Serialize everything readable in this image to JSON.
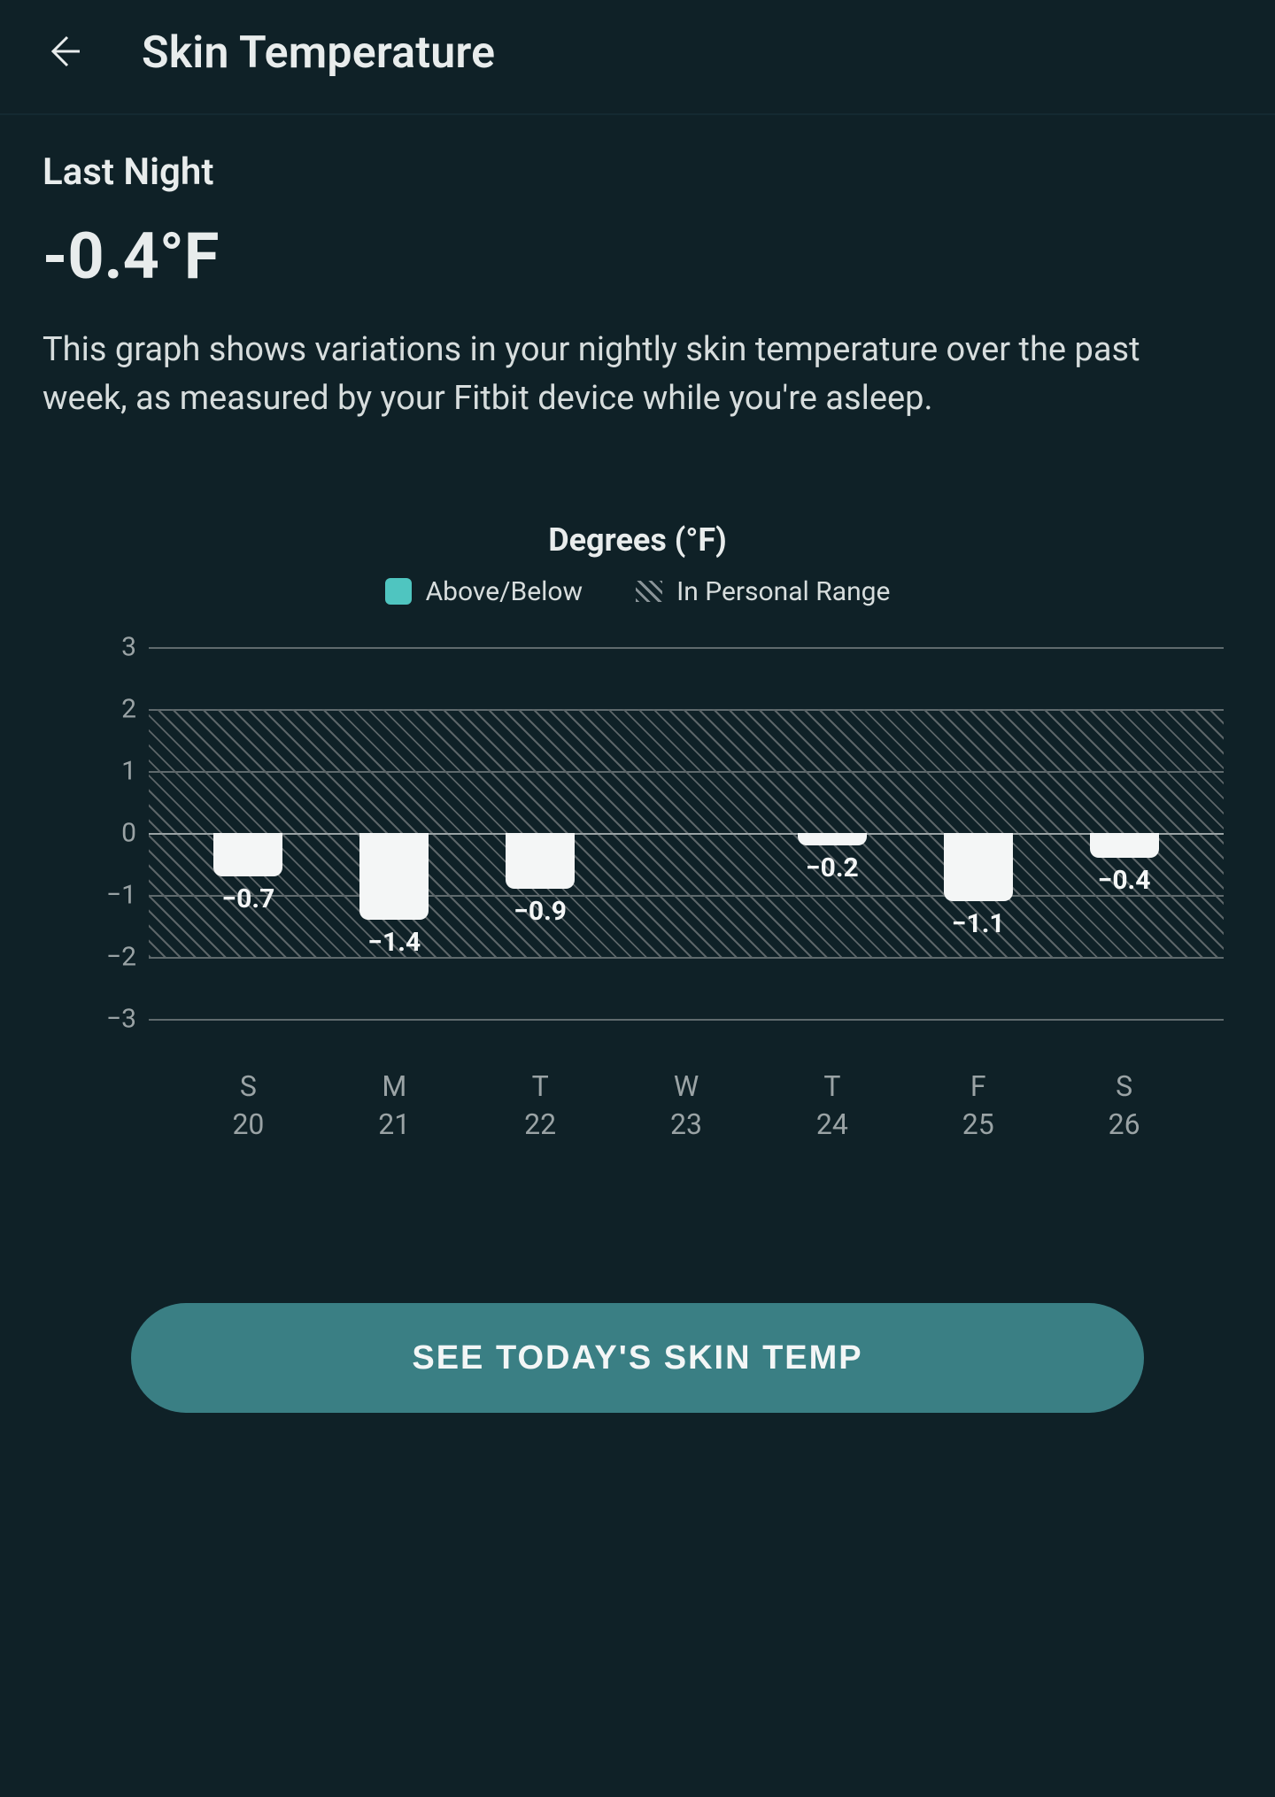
{
  "header": {
    "back_icon": "arrow-left",
    "title": "Skin Temperature"
  },
  "summary": {
    "section_label": "Last Night",
    "value": "-0.4°F",
    "description": "This graph shows variations in your nightly skin temperature over the past week, as measured by your Fitbit device while you're asleep."
  },
  "legend": {
    "above_below": "Above/Below",
    "in_range": "In Personal Range"
  },
  "cta": {
    "label": "SEE TODAY'S SKIN TEMP"
  },
  "colors": {
    "accent": "#4fc5c0",
    "button": "#3a7f84",
    "bar": "#f4f6f6",
    "bg": "#0f2127"
  },
  "chart_data": {
    "type": "bar",
    "title": "Degrees (°F)",
    "ylabel": "",
    "xlabel": "",
    "ylim": [
      -3,
      3
    ],
    "yticks": [
      3,
      2,
      1,
      0,
      -1,
      -2,
      -3
    ],
    "personal_range": [
      -2,
      2
    ],
    "categories_day": [
      "S",
      "M",
      "T",
      "W",
      "T",
      "F",
      "S"
    ],
    "categories_date": [
      "20",
      "21",
      "22",
      "23",
      "24",
      "25",
      "26"
    ],
    "values": [
      -0.7,
      -1.4,
      -0.9,
      null,
      -0.2,
      -1.1,
      -0.4
    ],
    "value_labels": [
      "−0.7",
      "−1.4",
      "−0.9",
      "",
      "−0.2",
      "−1.1",
      "−0.4"
    ]
  }
}
